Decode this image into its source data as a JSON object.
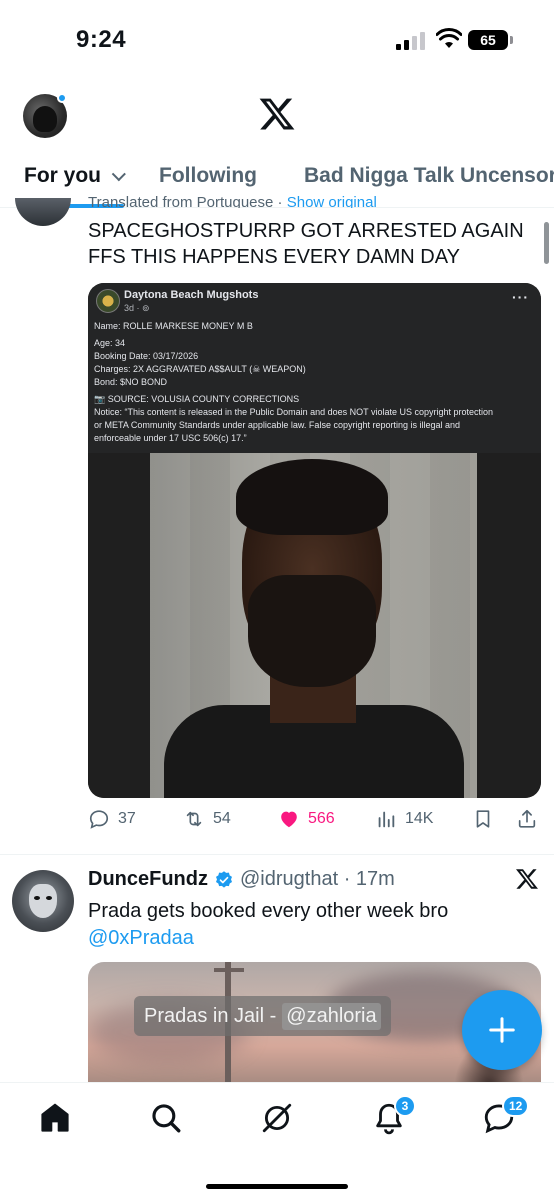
{
  "status_bar": {
    "time": "9:24",
    "battery": "65"
  },
  "header": {
    "logo": "x-logo"
  },
  "tabs": [
    {
      "label": "For you",
      "active": true
    },
    {
      "label": "Following",
      "active": false
    },
    {
      "label": "Bad Nigga Talk Uncensore",
      "active": false
    }
  ],
  "post1": {
    "translated_label": "Translated from Portuguese",
    "show_original": "Show original",
    "text": "SPACEGHOSTPURRP GOT ARRESTED AGAIN FFS THIS HAPPENS EVERY DAMN DAY",
    "media": {
      "page_name": "Daytona Beach Mugshots",
      "meta": "3d · ",
      "more": "···",
      "lines": [
        "Name:  ROLLE MARKESE MONEY   M B",
        "Age: 34",
        "Booking Date: 03/17/2026",
        "Charges:  2X AGGRAVATED A$$AULT (☠ WEAPON)",
        "Bond: $NO BOND",
        "📷 SOURCE: VOLUSIA COUNTY CORRECTIONS",
        "Notice: “This content is released in the Public Domain and does NOT violate US copyright protection",
        "or META Community Standards under applicable law. False copyright reporting is illegal and",
        "enforceable under 17 USC 506(c) 17.”"
      ]
    },
    "actions": {
      "replies": "37",
      "reposts": "54",
      "likes": "566",
      "views": "14K"
    }
  },
  "post2": {
    "name": "DunceFundz",
    "handle": "@idrugthat · 17m",
    "text": "Prada gets booked every other week bro",
    "mention": "@0xPradaa",
    "media_caption": "Pradas in Jail -",
    "media_caption_tag": "@zahloria"
  },
  "bottom_nav": {
    "notifications_badge": "3",
    "messages_badge": "12"
  },
  "colors": {
    "accent": "#1d9bf0",
    "like": "#f91880",
    "secondary_text": "#536471"
  }
}
